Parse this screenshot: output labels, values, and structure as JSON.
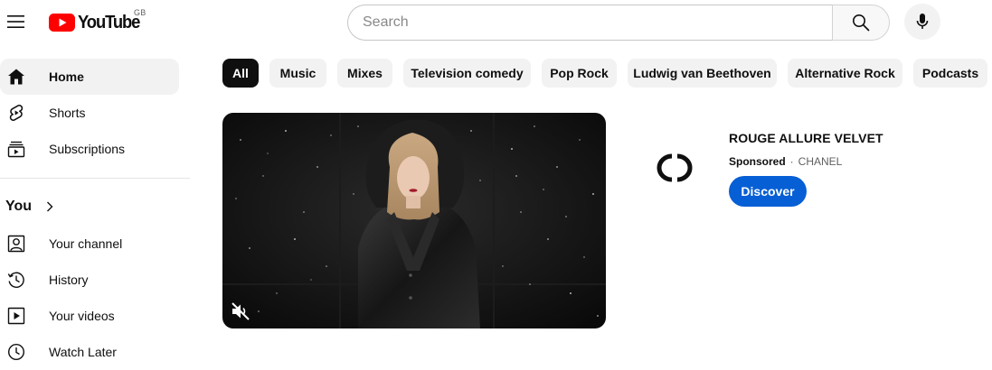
{
  "header": {
    "logo_text": "YouTube",
    "country_code": "GB",
    "search": {
      "placeholder": "Search",
      "value": ""
    },
    "brand_color": "#ff0000"
  },
  "sidebar": {
    "main_items": [
      {
        "label": "Home",
        "icon": "home-icon",
        "active": true
      },
      {
        "label": "Shorts",
        "icon": "shorts-icon",
        "active": false
      },
      {
        "label": "Subscriptions",
        "icon": "subscriptions-icon",
        "active": false
      }
    ],
    "you_section": {
      "title": "You",
      "items": [
        {
          "label": "Your channel",
          "icon": "your-channel-icon"
        },
        {
          "label": "History",
          "icon": "history-icon"
        },
        {
          "label": "Your videos",
          "icon": "your-videos-icon"
        },
        {
          "label": "Watch Later",
          "icon": "watch-later-icon"
        }
      ]
    }
  },
  "chips": [
    {
      "label": "All",
      "selected": true
    },
    {
      "label": "Music",
      "selected": false
    },
    {
      "label": "Mixes",
      "selected": false
    },
    {
      "label": "Television comedy",
      "selected": false
    },
    {
      "label": "Pop Rock",
      "selected": false
    },
    {
      "label": "Ludwig van Beethoven",
      "selected": false
    },
    {
      "label": "Alternative Rock",
      "selected": false
    },
    {
      "label": "Podcasts",
      "selected": false
    }
  ],
  "ad": {
    "title": "ROUGE ALLURE VELVET",
    "sponsored_label": "Sponsored",
    "separator": "·",
    "advertiser": "CHANEL",
    "cta_label": "Discover",
    "cta_color": "#065fd4",
    "muted": true
  }
}
